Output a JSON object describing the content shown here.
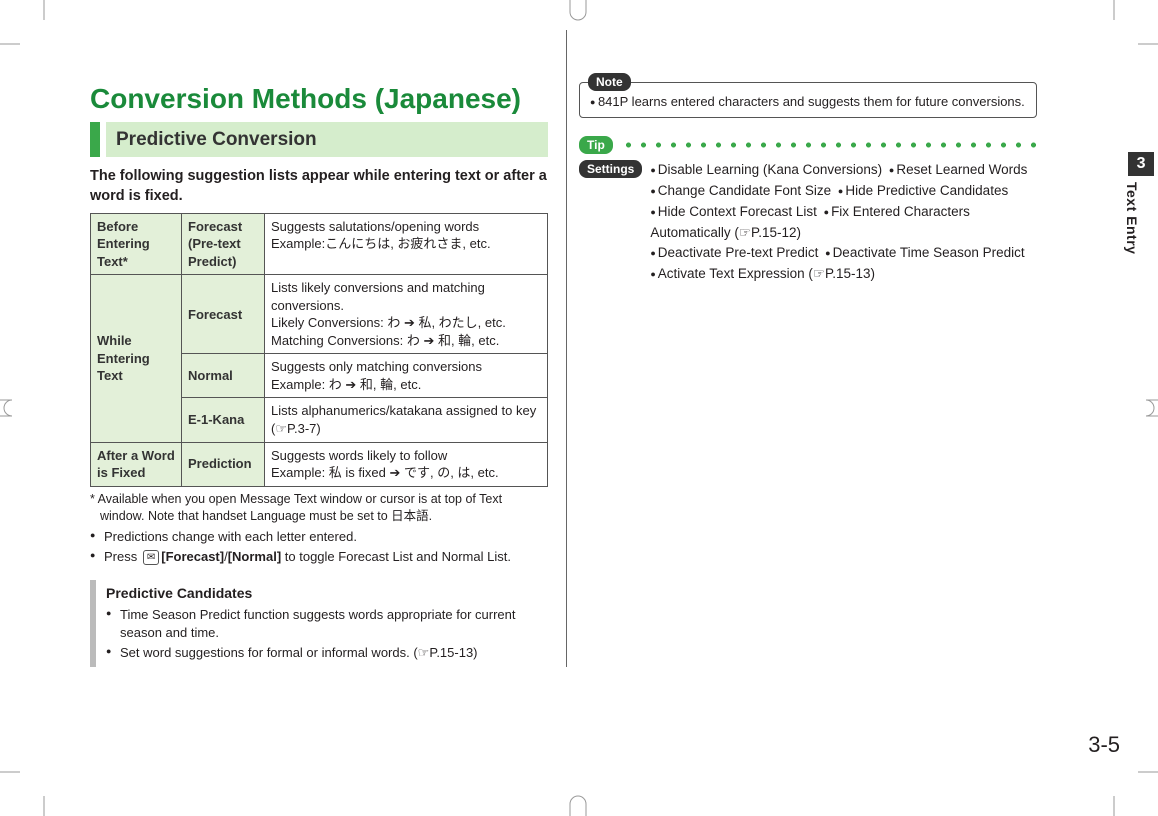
{
  "title": "Conversion Methods (Japanese)",
  "section": "Predictive Conversion",
  "intro": "The following suggestion lists appear while entering text or after a word is fixed.",
  "table": {
    "r1": {
      "phase": "Before Entering Text*",
      "mode": "Forecast (Pre-text Predict)",
      "desc": "Suggests salutations/opening words\nExample:こんにちは, お疲れさま, etc."
    },
    "r2": {
      "phase": "While Entering Text",
      "mode": "Forecast",
      "desc": "Lists likely conversions and matching conversions.\nLikely Conversions: わ ➔ 私, わたし, etc.\nMatching Conversions: わ ➔ 和, 輪, etc."
    },
    "r3": {
      "mode": "Normal",
      "desc": "Suggests only matching conversions\nExample: わ ➔ 和, 輪, etc."
    },
    "r4": {
      "mode": "E-1-Kana",
      "desc": "Lists alphanumerics/katakana assigned to key (☞P.3-7)"
    },
    "r5": {
      "phase": "After a Word is Fixed",
      "mode": "Prediction",
      "desc": "Suggests words likely to follow\nExample: 私 is fixed ➔ です, の, は, etc."
    }
  },
  "footnote": "* Available when you open Message Text window or cursor is at top of Text window. Note that handset Language must be set to 日本語.",
  "bullets": {
    "b1": "Predictions change with each letter entered.",
    "b2_pre": "Press ",
    "b2_key": "✉",
    "b2_mid1": "[Forecast]",
    "b2_slash": "/",
    "b2_mid2": "[Normal]",
    "b2_post": " to toggle Forecast List and Normal List."
  },
  "subbox": {
    "title": "Predictive Candidates",
    "i1": "Time Season Predict function suggests words appropriate for current season and time.",
    "i2": "Set word suggestions for formal or informal words. (☞P.15-13)"
  },
  "note": {
    "label": "Note",
    "text": "841P learns entered characters and suggests them for future conversions."
  },
  "tip": {
    "label": "Tip"
  },
  "settings": {
    "label": "Settings",
    "items": {
      "s1": "Disable Learning (Kana Conversions)",
      "s2": "Reset Learned Words",
      "s3": "Change Candidate Font Size",
      "s4": "Hide Predictive Candidates",
      "s5": "Hide Context Forecast List",
      "s6": "Fix Entered Characters Automatically (☞P.15-12)",
      "s7": "Deactivate Pre-text Predict",
      "s8": "Deactivate Time Season Predict",
      "s9": "Activate Text Expression (☞P.15-13)"
    }
  },
  "sidetab": {
    "num": "3",
    "label": "Text Entry"
  },
  "page_num": "3-5"
}
